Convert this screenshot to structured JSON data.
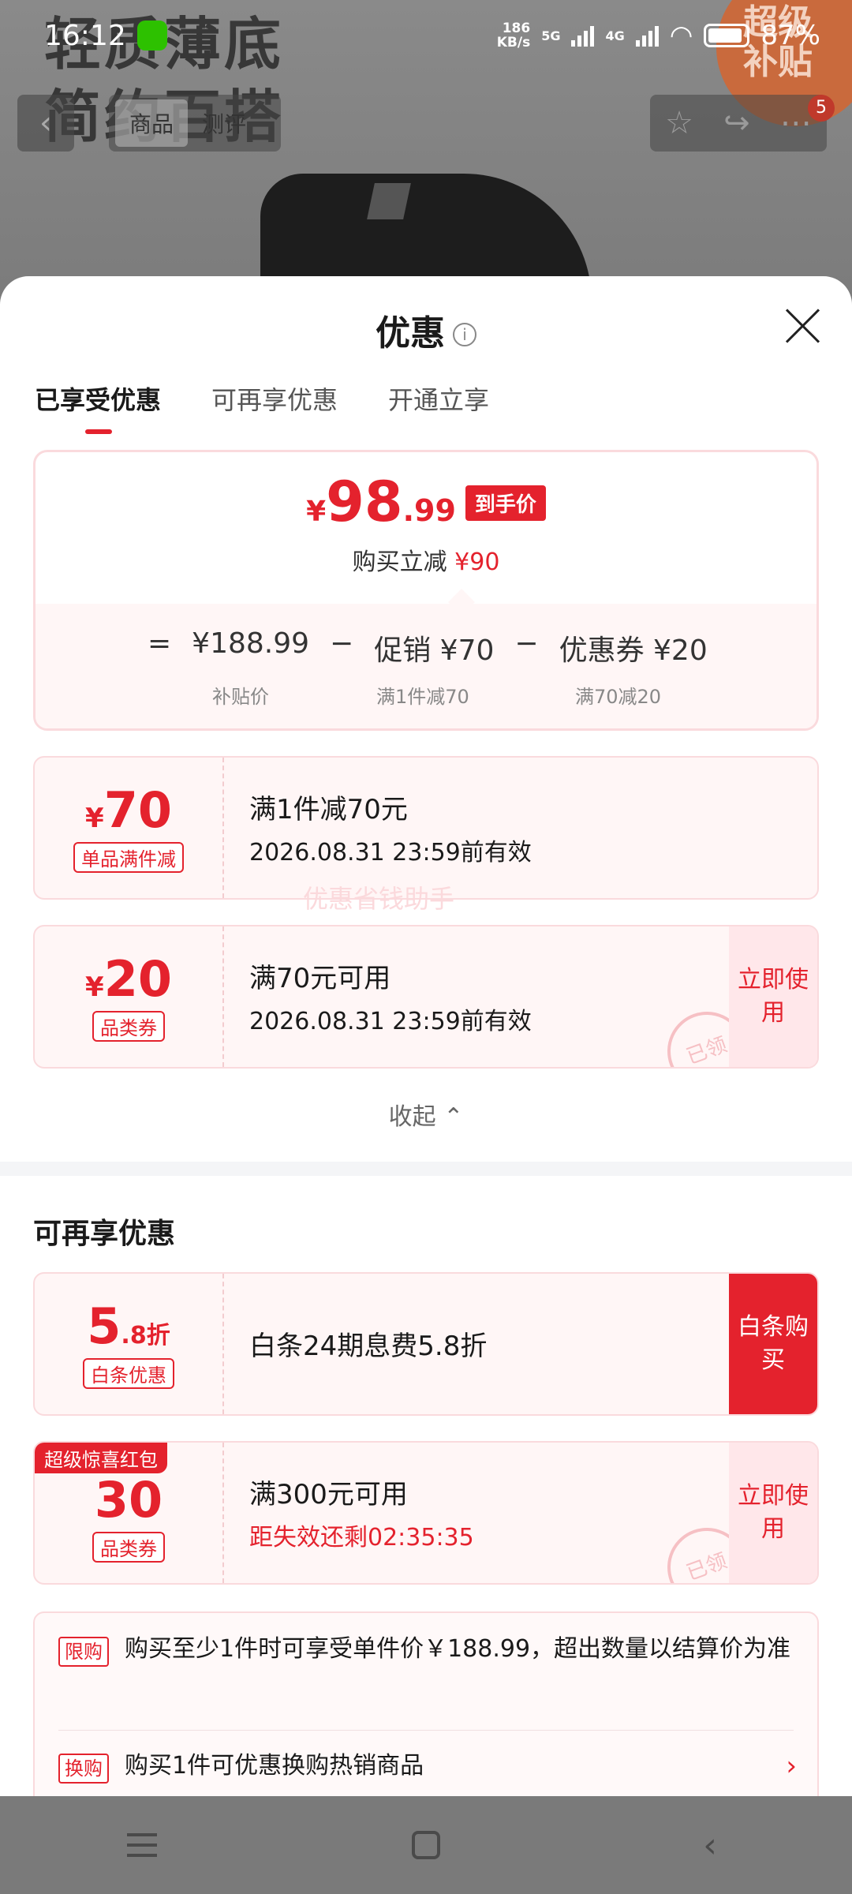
{
  "status_bar": {
    "time": "16:12",
    "net_speed_value": "186",
    "net_speed_unit": "KB/s",
    "sig1": "5G",
    "sig2": "4G",
    "battery": "87%"
  },
  "background": {
    "headline_line1": "轻质薄底",
    "headline_line2": "简约百搭",
    "badge_line1": "超级",
    "badge_line2": "补贴",
    "tab_product": "商品",
    "tab_review": "测评",
    "badge_count": "5"
  },
  "sheet": {
    "title": "优惠",
    "tabs": [
      "已享受优惠",
      "可再享优惠",
      "开通立享"
    ],
    "summary": {
      "currency": "¥",
      "price_int": "98",
      "price_dec": ".99",
      "price_tag": "到手价",
      "instant_label": "购买立减",
      "instant_value": "¥90",
      "formula": [
        "=",
        "¥188.99",
        "−",
        "促销 ¥70",
        "−",
        "优惠券 ¥20"
      ],
      "formula_sub": [
        "补贴价",
        "满1件减70",
        "满70减20"
      ]
    },
    "enjoyed_coupons": [
      {
        "currency": "¥",
        "amount": "70",
        "tag": "单品满件减",
        "title": "满1件减70元",
        "validity": "2026.08.31 23:59前有效"
      },
      {
        "currency": "¥",
        "amount": "20",
        "tag": "品类券",
        "title": "满70元可用",
        "validity": "2026.08.31 23:59前有效",
        "button": "立即使用",
        "stamp": "已领"
      }
    ],
    "watermark": "优惠省钱助手",
    "collapse_label": "收起",
    "more_section_title": "可再享优惠",
    "more_coupons": [
      {
        "amount": "5",
        "suffix": ".8折",
        "tag": "白条优惠",
        "title": "白条24期息费5.8折",
        "button": "白条购买"
      },
      {
        "ribbon": "超级惊喜红包",
        "amount": "30",
        "tag": "品类券",
        "title": "满300元可用",
        "countdown": "距失效还剩02:35:35",
        "button": "立即使用",
        "stamp": "已领"
      }
    ],
    "notes": [
      {
        "tag": "限购",
        "text": "购买至少1件时可享受单件价￥188.99，超出数量以结算价为准"
      },
      {
        "tag": "换购",
        "text": "购买1件可优惠换购热销商品"
      }
    ]
  },
  "colors": {
    "accent": "#e4222d",
    "card_bg": "#fff6f6",
    "card_border": "#fadadd"
  }
}
